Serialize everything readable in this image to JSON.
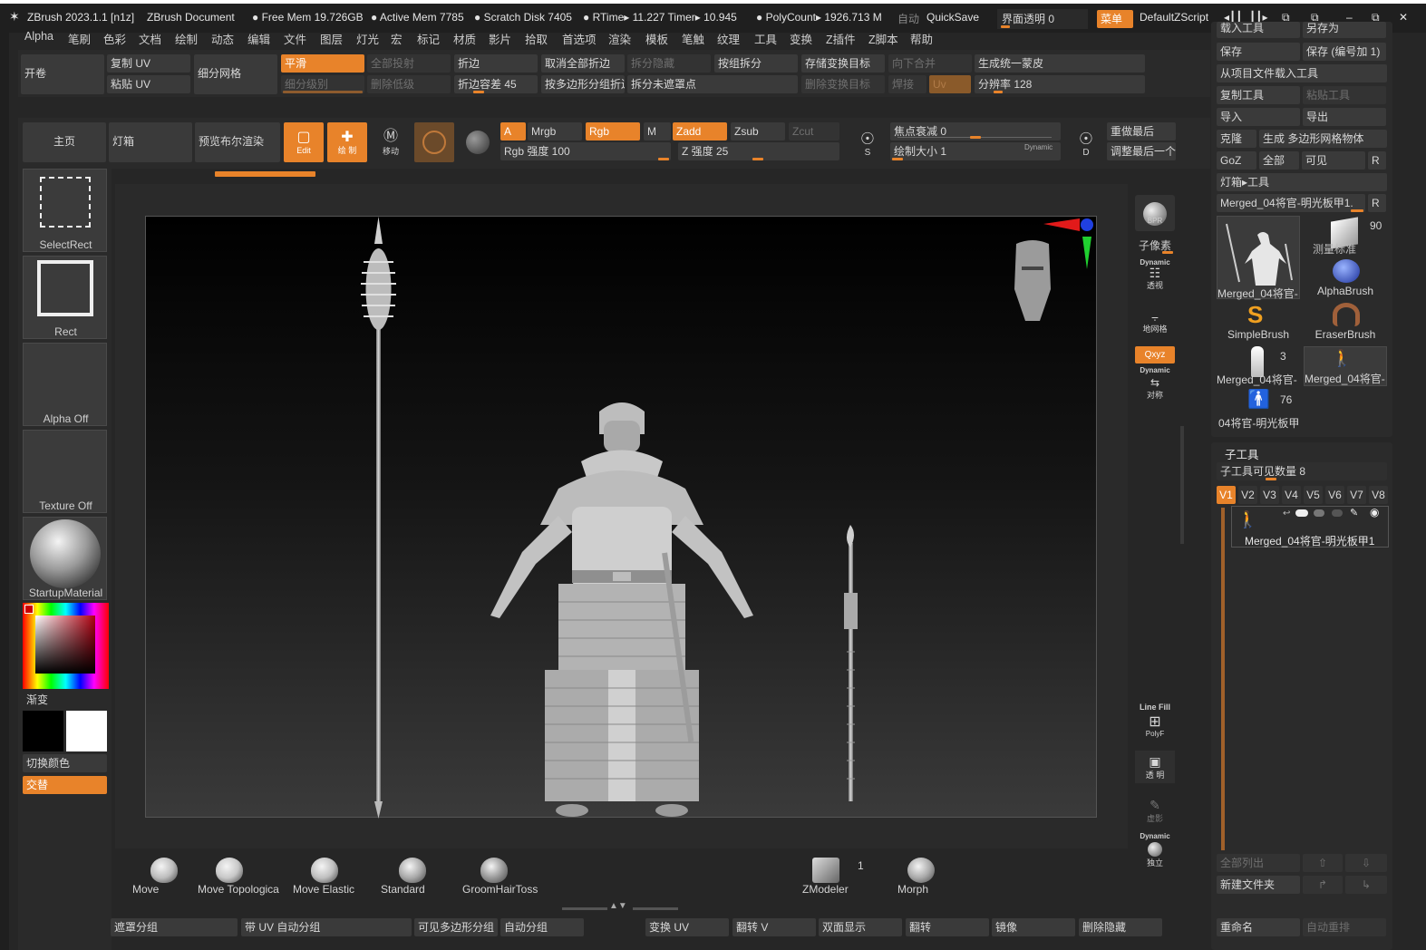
{
  "titlebar": {
    "app": "ZBrush 2023.1.1 [n1z]",
    "document": "ZBrush Document",
    "free_mem": "Free Mem 19.726GB",
    "active_mem": "Active Mem 7785",
    "scratch_disk": "Scratch Disk 7405",
    "rtime": "RTime▸ 11.227 Timer▸ 10.945",
    "polycount": "PolyCount▸ 1926.713 M",
    "auto": "自动",
    "quicksave": "QuickSave",
    "transparency": "界面透明 0",
    "menu": "菜单",
    "script": "DefaultZScript"
  },
  "menus": [
    "Alpha",
    "笔刷",
    "色彩",
    "文档",
    "绘制",
    "动态",
    "编辑",
    "文件",
    "图层",
    "灯光",
    "宏",
    "标记",
    "材质",
    "影片",
    "拾取",
    "首选项",
    "渲染",
    "模板",
    "笔触",
    "纹理",
    "工具",
    "变换",
    "Z插件",
    "Z脚本",
    "帮助"
  ],
  "shelf1": {
    "open": "开卷",
    "copy_uv": "复制 UV",
    "paste_uv": "粘贴 UV",
    "subdivide": "细分网格",
    "smooth": "平滑",
    "subdiv_level": "细分级别",
    "project_all": "全部投射",
    "del_lower": "删除低级",
    "crease": "折边",
    "crease_tol": "折边容差 45",
    "uncrease_all": "取消全部折边",
    "crease_pg": "按多边形分组折边",
    "split_hidden": "拆分隐藏",
    "split_unmasked": "拆分未遮罩点",
    "split_groups": "按组拆分",
    "store_morph": "存储变换目标",
    "del_morph": "删除变换目标",
    "merge_down": "向下合并",
    "weld": "焊接",
    "uv": "Uv",
    "unified_skin": "生成统一蒙皮",
    "resolution": "分辨率 128"
  },
  "shelf2": {
    "home": "主页",
    "lightbox": "灯箱",
    "preview_bool": "预览布尔渲染",
    "edit": "Edit",
    "draw": "绘 制",
    "move": "移动",
    "a": "A",
    "mrgb": "Mrgb",
    "rgb": "Rgb",
    "m": "M",
    "zadd": "Zadd",
    "zsub": "Zsub",
    "zcut": "Zcut",
    "rgb_intensity": "Rgb 强度 100",
    "z_intensity": "Z 强度 25",
    "focal_shift": "焦点衰减 0",
    "draw_size": "绘制大小 1",
    "dynamic": "Dynamic",
    "redo_last": "重做最后",
    "adjust_last": "调整最后一个",
    "s_label": "S",
    "d_label": "D"
  },
  "left_panel": {
    "select_rect": "SelectRect",
    "rect": "Rect",
    "alpha_off": "Alpha Off",
    "texture_off": "Texture Off",
    "material": "StartupMaterial",
    "gradient": "渐变",
    "switch_color": "切换颜色",
    "alternate": "交替"
  },
  "right_tray": {
    "bpr": "BPR",
    "subpixel": "子像素",
    "dynamic": "Dynamic",
    "perspective": "透视",
    "floor": "地网格",
    "xyz": "Qxyz",
    "symmetry": "对称",
    "line_fill": "Line Fill",
    "polyf": "PolyF",
    "transparent": "透 明",
    "ghost": "虚影",
    "solo": "独立"
  },
  "tool_panel": {
    "load_tool": "载入工具",
    "save_as": "另存为",
    "save": "保存",
    "save_inc": "保存 (编号加 1)",
    "load_from_project": "从项目文件载入工具",
    "copy_tool": "复制工具",
    "paste_tool": "粘贴工具",
    "import": "导入",
    "export": "导出",
    "clone": "克隆",
    "make_polymesh": "生成 多边形网格物体",
    "goz": "GoZ",
    "all": "全部",
    "visible": "可见",
    "r": "R",
    "lightbox_tools": "灯箱▸工具",
    "current_tool": "Merged_04将官-明光板甲1.",
    "thumb_count": "90",
    "tools": [
      {
        "label": "Merged_04将官-"
      },
      {
        "label": "测量标准"
      },
      {
        "label": "AlphaBrush"
      },
      {
        "label": "SimpleBrush"
      },
      {
        "label": "EraserBrush"
      },
      {
        "label": "Merged_04将官-",
        "count": "3"
      },
      {
        "label": "Merged_04将官-"
      },
      {
        "label": "04将官-明光板甲",
        "count": "76"
      }
    ]
  },
  "subtool": {
    "header": "子工具",
    "visible_count": "子工具可见数量 8",
    "tabs": [
      "V1",
      "V2",
      "V3",
      "V4",
      "V5",
      "V6",
      "V7",
      "V8"
    ],
    "item": "Merged_04将官-明光板甲1",
    "list_all": "全部列出",
    "new_folder": "新建文件夹",
    "rename": "重命名",
    "auto_reorder": "自动重排"
  },
  "brushes": [
    {
      "name": "Move"
    },
    {
      "name": "Move Topologica"
    },
    {
      "name": "Move Elastic"
    },
    {
      "name": "Standard"
    },
    {
      "name": "GroomHairToss"
    }
  ],
  "brushes_right": [
    {
      "name": "ZModeler",
      "count": "1"
    },
    {
      "name": "Morph"
    }
  ],
  "bottom_bar": {
    "mask_groups": "遮罩分组",
    "uv_groups": "带 UV 自动分组",
    "visible_pg": "可见多边形分组",
    "auto_groups": "自动分组",
    "transform_uv": "变换 UV",
    "flip_v": "翻转 V",
    "double_sided": "双面显示",
    "flip": "翻转",
    "mirror": "镜像",
    "del_hidden": "删除隐藏"
  },
  "colors": {
    "accent": "#e8832a",
    "bg": "#262626",
    "panel": "#2d2d2d",
    "button": "#3a3a3a"
  }
}
